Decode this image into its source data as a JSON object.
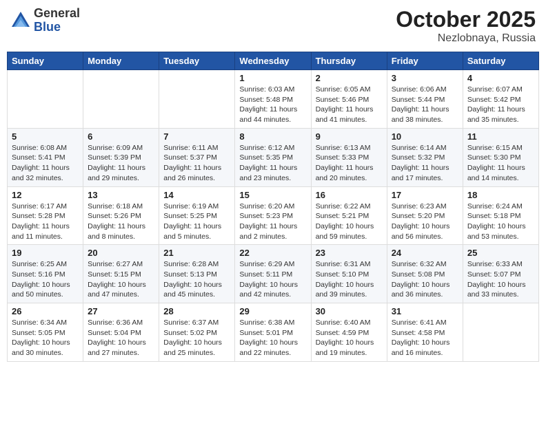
{
  "header": {
    "logo": {
      "general": "General",
      "blue": "Blue"
    },
    "title": "October 2025",
    "location": "Nezlobnaya, Russia"
  },
  "weekdays": [
    "Sunday",
    "Monday",
    "Tuesday",
    "Wednesday",
    "Thursday",
    "Friday",
    "Saturday"
  ],
  "weeks": [
    [
      {
        "day": "",
        "info": ""
      },
      {
        "day": "",
        "info": ""
      },
      {
        "day": "",
        "info": ""
      },
      {
        "day": "1",
        "info": "Sunrise: 6:03 AM\nSunset: 5:48 PM\nDaylight: 11 hours\nand 44 minutes."
      },
      {
        "day": "2",
        "info": "Sunrise: 6:05 AM\nSunset: 5:46 PM\nDaylight: 11 hours\nand 41 minutes."
      },
      {
        "day": "3",
        "info": "Sunrise: 6:06 AM\nSunset: 5:44 PM\nDaylight: 11 hours\nand 38 minutes."
      },
      {
        "day": "4",
        "info": "Sunrise: 6:07 AM\nSunset: 5:42 PM\nDaylight: 11 hours\nand 35 minutes."
      }
    ],
    [
      {
        "day": "5",
        "info": "Sunrise: 6:08 AM\nSunset: 5:41 PM\nDaylight: 11 hours\nand 32 minutes."
      },
      {
        "day": "6",
        "info": "Sunrise: 6:09 AM\nSunset: 5:39 PM\nDaylight: 11 hours\nand 29 minutes."
      },
      {
        "day": "7",
        "info": "Sunrise: 6:11 AM\nSunset: 5:37 PM\nDaylight: 11 hours\nand 26 minutes."
      },
      {
        "day": "8",
        "info": "Sunrise: 6:12 AM\nSunset: 5:35 PM\nDaylight: 11 hours\nand 23 minutes."
      },
      {
        "day": "9",
        "info": "Sunrise: 6:13 AM\nSunset: 5:33 PM\nDaylight: 11 hours\nand 20 minutes."
      },
      {
        "day": "10",
        "info": "Sunrise: 6:14 AM\nSunset: 5:32 PM\nDaylight: 11 hours\nand 17 minutes."
      },
      {
        "day": "11",
        "info": "Sunrise: 6:15 AM\nSunset: 5:30 PM\nDaylight: 11 hours\nand 14 minutes."
      }
    ],
    [
      {
        "day": "12",
        "info": "Sunrise: 6:17 AM\nSunset: 5:28 PM\nDaylight: 11 hours\nand 11 minutes."
      },
      {
        "day": "13",
        "info": "Sunrise: 6:18 AM\nSunset: 5:26 PM\nDaylight: 11 hours\nand 8 minutes."
      },
      {
        "day": "14",
        "info": "Sunrise: 6:19 AM\nSunset: 5:25 PM\nDaylight: 11 hours\nand 5 minutes."
      },
      {
        "day": "15",
        "info": "Sunrise: 6:20 AM\nSunset: 5:23 PM\nDaylight: 11 hours\nand 2 minutes."
      },
      {
        "day": "16",
        "info": "Sunrise: 6:22 AM\nSunset: 5:21 PM\nDaylight: 10 hours\nand 59 minutes."
      },
      {
        "day": "17",
        "info": "Sunrise: 6:23 AM\nSunset: 5:20 PM\nDaylight: 10 hours\nand 56 minutes."
      },
      {
        "day": "18",
        "info": "Sunrise: 6:24 AM\nSunset: 5:18 PM\nDaylight: 10 hours\nand 53 minutes."
      }
    ],
    [
      {
        "day": "19",
        "info": "Sunrise: 6:25 AM\nSunset: 5:16 PM\nDaylight: 10 hours\nand 50 minutes."
      },
      {
        "day": "20",
        "info": "Sunrise: 6:27 AM\nSunset: 5:15 PM\nDaylight: 10 hours\nand 47 minutes."
      },
      {
        "day": "21",
        "info": "Sunrise: 6:28 AM\nSunset: 5:13 PM\nDaylight: 10 hours\nand 45 minutes."
      },
      {
        "day": "22",
        "info": "Sunrise: 6:29 AM\nSunset: 5:11 PM\nDaylight: 10 hours\nand 42 minutes."
      },
      {
        "day": "23",
        "info": "Sunrise: 6:31 AM\nSunset: 5:10 PM\nDaylight: 10 hours\nand 39 minutes."
      },
      {
        "day": "24",
        "info": "Sunrise: 6:32 AM\nSunset: 5:08 PM\nDaylight: 10 hours\nand 36 minutes."
      },
      {
        "day": "25",
        "info": "Sunrise: 6:33 AM\nSunset: 5:07 PM\nDaylight: 10 hours\nand 33 minutes."
      }
    ],
    [
      {
        "day": "26",
        "info": "Sunrise: 6:34 AM\nSunset: 5:05 PM\nDaylight: 10 hours\nand 30 minutes."
      },
      {
        "day": "27",
        "info": "Sunrise: 6:36 AM\nSunset: 5:04 PM\nDaylight: 10 hours\nand 27 minutes."
      },
      {
        "day": "28",
        "info": "Sunrise: 6:37 AM\nSunset: 5:02 PM\nDaylight: 10 hours\nand 25 minutes."
      },
      {
        "day": "29",
        "info": "Sunrise: 6:38 AM\nSunset: 5:01 PM\nDaylight: 10 hours\nand 22 minutes."
      },
      {
        "day": "30",
        "info": "Sunrise: 6:40 AM\nSunset: 4:59 PM\nDaylight: 10 hours\nand 19 minutes."
      },
      {
        "day": "31",
        "info": "Sunrise: 6:41 AM\nSunset: 4:58 PM\nDaylight: 10 hours\nand 16 minutes."
      },
      {
        "day": "",
        "info": ""
      }
    ]
  ]
}
